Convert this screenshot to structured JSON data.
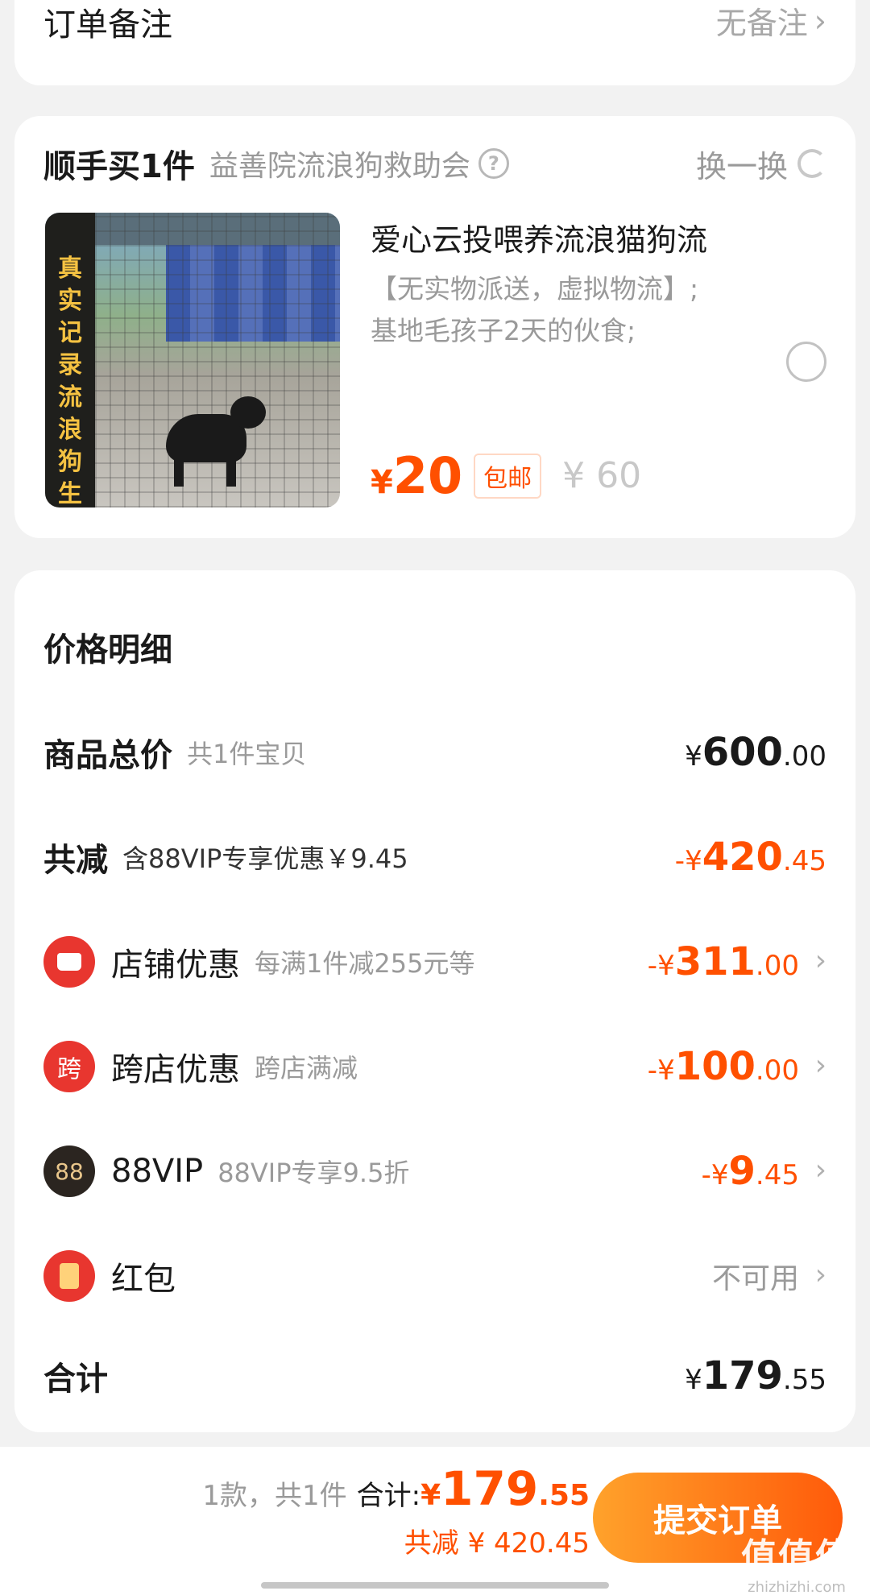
{
  "remark": {
    "label": "订单备注",
    "value": "无备注"
  },
  "addon": {
    "title": "顺手买1件",
    "shop": "益善院流浪狗救助会",
    "swap_label": "换一换",
    "thumb_text": "真实记录流浪狗生活",
    "name": "爱心云投喂养流浪猫狗流",
    "desc_line1": "【无实物派送，虚拟物流】;",
    "desc_line2": "基地毛孩子2天的伙食;",
    "price_symbol": "¥",
    "price": "20",
    "shipping_badge": "包邮",
    "original_price": "¥ 60"
  },
  "detail": {
    "title": "价格明细",
    "rows": [
      {
        "label": "商品总价",
        "sub": "共1件宝贝",
        "sign": "",
        "sym": "¥",
        "int": "600",
        "dec": ".00"
      },
      {
        "label": "共减",
        "sub": "含88VIP专享优惠￥9.45",
        "sign": "- ",
        "sym": "¥",
        "int": "420",
        "dec": ".45"
      },
      {
        "label": "店铺优惠",
        "sub": "每满1件减255元等",
        "sign": "- ",
        "sym": "¥",
        "int": "311",
        "dec": ".00"
      },
      {
        "label": "跨店优惠",
        "sub": "跨店满减",
        "sign": "- ",
        "sym": "¥",
        "int": "100",
        "dec": ".00",
        "icon_text": "跨"
      },
      {
        "label": "88VIP",
        "sub": "88VIP专享9.5折",
        "sign": "- ",
        "sym": "¥",
        "int": "9",
        "dec": ".45",
        "icon_text": "88"
      },
      {
        "label": "红包",
        "value": "不可用"
      },
      {
        "label": "合计",
        "sign": "",
        "sym": "¥",
        "int": "179",
        "dec": ".55"
      }
    ]
  },
  "bottom": {
    "count": "1款，共1件",
    "total_label": "合计:",
    "total_sym": "¥",
    "total_int": "179",
    "total_dec": ".55",
    "saved": "共减 ¥ 420.45",
    "submit_label": "提交订单",
    "watermark_logo": "值值值",
    "watermark_url": "zhizhizhi.com"
  },
  "colors": {
    "accent": "#ff5000",
    "icon_red": "#e8362f",
    "vip_dark": "#2b2520"
  }
}
